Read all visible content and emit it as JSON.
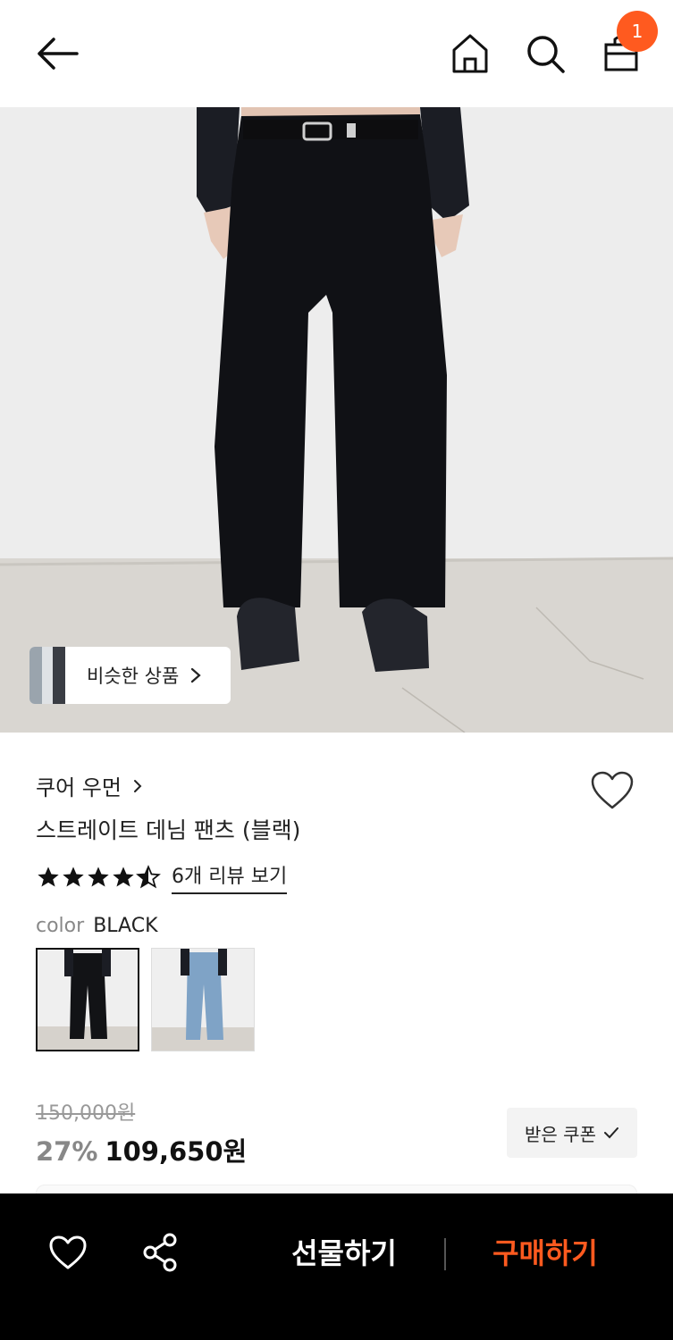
{
  "header": {
    "cart_count": "1",
    "icons": [
      "back-arrow-icon",
      "home-icon",
      "search-icon",
      "shopping-bag-icon"
    ]
  },
  "hero": {
    "similar_label": "비슷한 상품"
  },
  "product": {
    "brand": "쿠어 우먼",
    "title": "스트레이트 데님 팬츠 (블랙)",
    "rating": 4.5,
    "review_link": "6개 리뷰 보기",
    "color_key": "color",
    "color_value": "BLACK",
    "original_price": "150,000원",
    "discount": "27%",
    "price": "109,650원",
    "coupon_label": "받은 쿠폰"
  },
  "bottom_bar": {
    "gift_label": "선물하기",
    "buy_label": "구매하기"
  },
  "colors": {
    "accent": "#ff5a1f",
    "bar_bg": "#000000"
  }
}
